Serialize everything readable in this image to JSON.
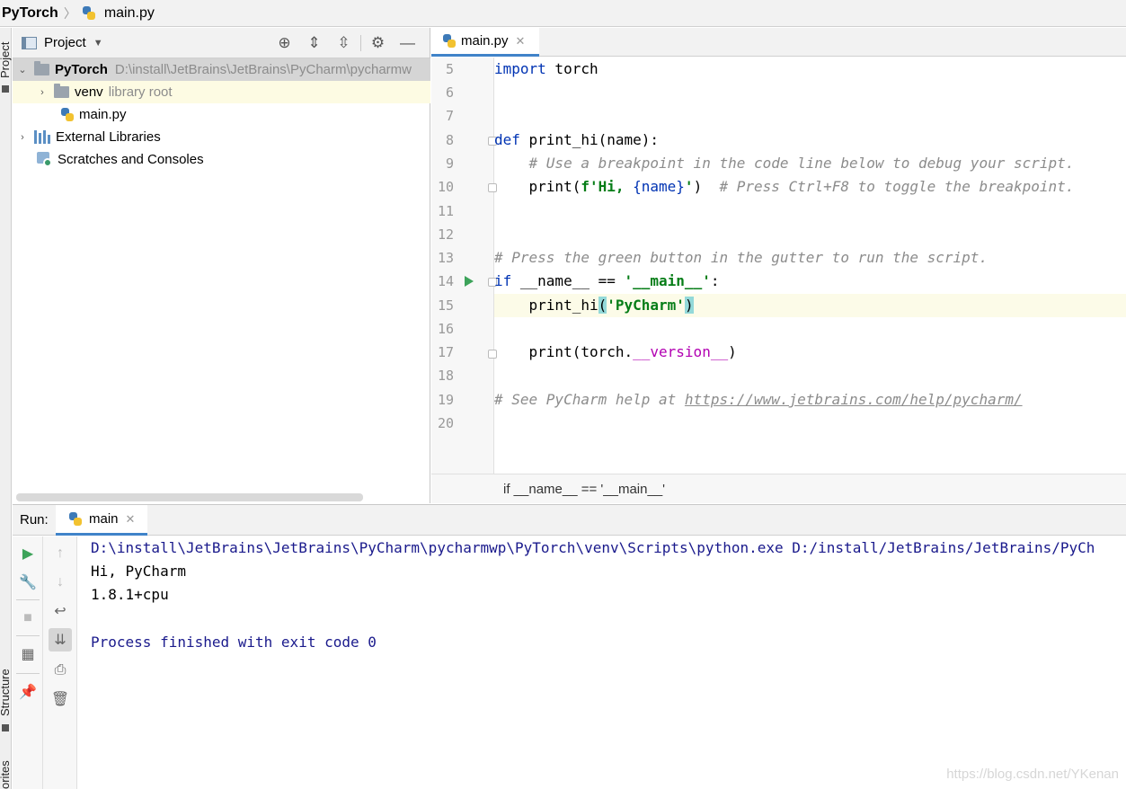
{
  "breadcrumb": {
    "project": "PyTorch",
    "file": "main.py"
  },
  "left_strip": {
    "top_tab": "Project",
    "mid_tab": "Structure",
    "bottom_tab": "orites"
  },
  "project_panel": {
    "title": "Project",
    "tree": [
      {
        "label": "PyTorch",
        "detail": "D:\\install\\JetBrains\\JetBrains\\PyCharm\\pycharmw"
      },
      {
        "label": "venv",
        "detail": "library root"
      },
      {
        "label": "main.py",
        "detail": ""
      },
      {
        "label": "External Libraries",
        "detail": ""
      },
      {
        "label": "Scratches and Consoles",
        "detail": ""
      }
    ]
  },
  "editor": {
    "tab_label": "main.py",
    "line_numbers": [
      "5",
      "6",
      "7",
      "8",
      "9",
      "10",
      "11",
      "12",
      "13",
      "14",
      "15",
      "16",
      "17",
      "18",
      "19",
      "20"
    ],
    "lines": {
      "l5_kw": "import",
      "l5_rest": " torch",
      "l8_kw": "def",
      "l8_rest": " print_hi(name):",
      "l9": "    # Use a breakpoint in the code line below to debug your script.",
      "l10_a": "    print(",
      "l10_str": "f'Hi, ",
      "l10_b": "{name}",
      "l10_str2": "'",
      "l10_c": ")  ",
      "l10_cmt": "# Press Ctrl+F8 to toggle the breakpoint.",
      "l13": "# Press the green button in the gutter to run the script.",
      "l14_kw": "if",
      "l14_a": " __name__ == ",
      "l14_str": "'__main__'",
      "l14_b": ":",
      "l15_a": "    print_hi",
      "l15_open": "(",
      "l15_str": "'PyCharm'",
      "l15_close": ")",
      "l17_a": "    print(torch.",
      "l17_dunder": "__version__",
      "l17_b": ")",
      "l19_cmt": "# See PyCharm help at ",
      "l19_link": "https://www.jetbrains.com/help/pycharm/"
    },
    "breadcrumb": "if __name__ == '__main__'"
  },
  "run_panel": {
    "label": "Run:",
    "tab_label": "main",
    "console": [
      "D:\\install\\JetBrains\\JetBrains\\PyCharm\\pycharmwp\\PyTorch\\venv\\Scripts\\python.exe D:/install/JetBrains/JetBrains/PyCh",
      "Hi, PyCharm",
      "1.8.1+cpu",
      "Process finished with exit code 0"
    ]
  },
  "watermark": "https://blog.csdn.net/YKenan",
  "colors": {
    "accent": "#4083c9",
    "keyword": "#0033b3",
    "string": "#067d17",
    "comment": "#8c8c8c",
    "run_green": "#3da35a"
  }
}
